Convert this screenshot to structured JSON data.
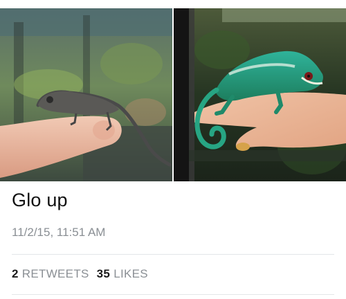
{
  "tweet": {
    "text": "Glo up",
    "timestamp": "11/2/15, 11:51 AM",
    "retweets_count": "2",
    "retweets_label": "RETWEETS",
    "likes_count": "35",
    "likes_label": "LIKES"
  },
  "media": [
    {
      "subject": "juvenile gray chameleon on fingertip"
    },
    {
      "subject": "adult green panther chameleon on hand"
    }
  ]
}
